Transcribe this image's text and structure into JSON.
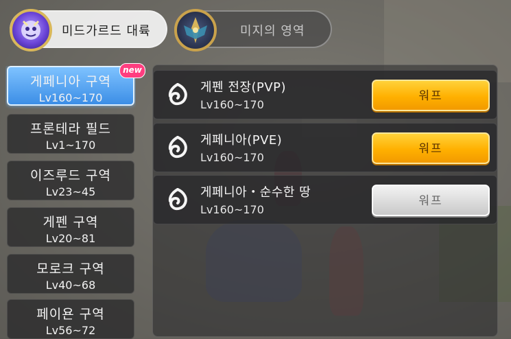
{
  "tabs": [
    {
      "label": "미드가르드 대륙",
      "active": true,
      "emblem": "midgard-crest-icon"
    },
    {
      "label": "미지의 영역",
      "active": false,
      "emblem": "unknown-realm-crest-icon"
    }
  ],
  "zones": [
    {
      "name": "게페니아 구역",
      "level": "Lv160~170",
      "active": true
    },
    {
      "name": "프론테라 필드",
      "level": "Lv1~170",
      "active": false
    },
    {
      "name": "이즈루드 구역",
      "level": "Lv23~45",
      "active": false
    },
    {
      "name": "게펜 구역",
      "level": "Lv20~81",
      "active": false
    },
    {
      "name": "모로크 구역",
      "level": "Lv40~68",
      "active": false
    },
    {
      "name": "페이욘 구역",
      "level": "Lv56~72",
      "active": false
    }
  ],
  "new_badge": "new",
  "maps": [
    {
      "name": "게펜 전장(PVP)",
      "level": "Lv160~170",
      "warp_label": "워프",
      "enabled": true,
      "icon": "swirl-map-icon"
    },
    {
      "name": "게페니아(PVE)",
      "level": "Lv160~170",
      "warp_label": "워프",
      "enabled": true,
      "icon": "swirl-map-icon"
    },
    {
      "name": "게페니아・순수한 땅",
      "level": "Lv160~170",
      "warp_label": "워프",
      "enabled": false,
      "icon": "swirl-map-icon"
    }
  ],
  "colors": {
    "accent_blue": "#3c8ee6",
    "warp_orange": "#ffb000",
    "new_pink": "#ff3d7f"
  }
}
